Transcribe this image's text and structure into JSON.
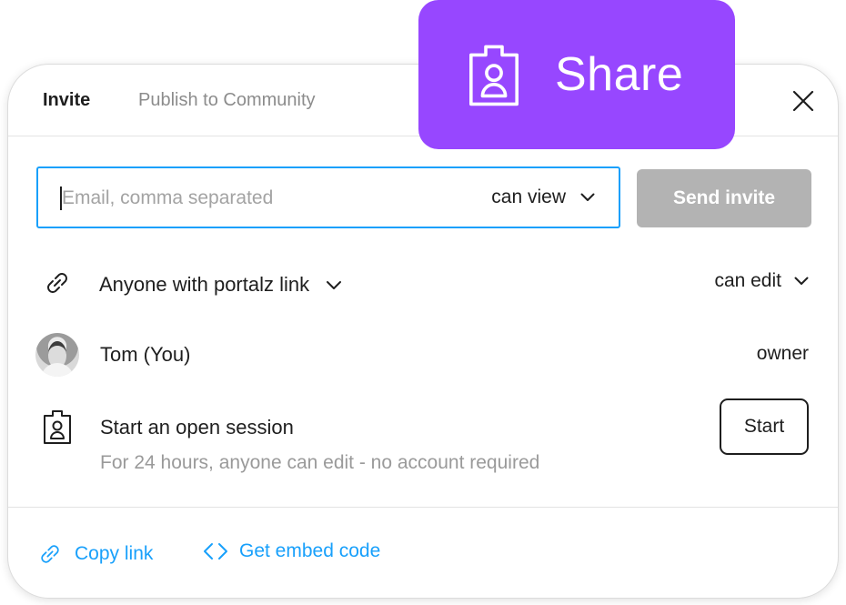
{
  "tabs": [
    {
      "label": "Invite",
      "active": true
    },
    {
      "label": "Publish to Community",
      "active": false
    }
  ],
  "invite": {
    "email_placeholder": "Email, comma separated",
    "email_value": "",
    "permission": "can view",
    "send_label": "Send invite"
  },
  "link_access": {
    "label": "Anyone with portalz link",
    "permission": "can edit"
  },
  "members": [
    {
      "name": "Tom (You)",
      "role": "owner"
    }
  ],
  "open_session": {
    "title": "Start an open session",
    "description": "For 24 hours, anyone can edit - no account required",
    "button_label": "Start"
  },
  "footer": {
    "copy_link": "Copy link",
    "embed_code": "Get embed code"
  },
  "badge": {
    "label": "Share"
  },
  "colors": {
    "accent_blue": "#18a0fb",
    "badge_purple": "#9747ff",
    "disabled_button": "#b3b3b3",
    "muted_text": "#9a9a9a"
  },
  "icons": {
    "close": "close-icon",
    "link": "link-icon",
    "session": "badge-icon",
    "code": "code-icon",
    "chevron": "chevron-down-icon"
  }
}
